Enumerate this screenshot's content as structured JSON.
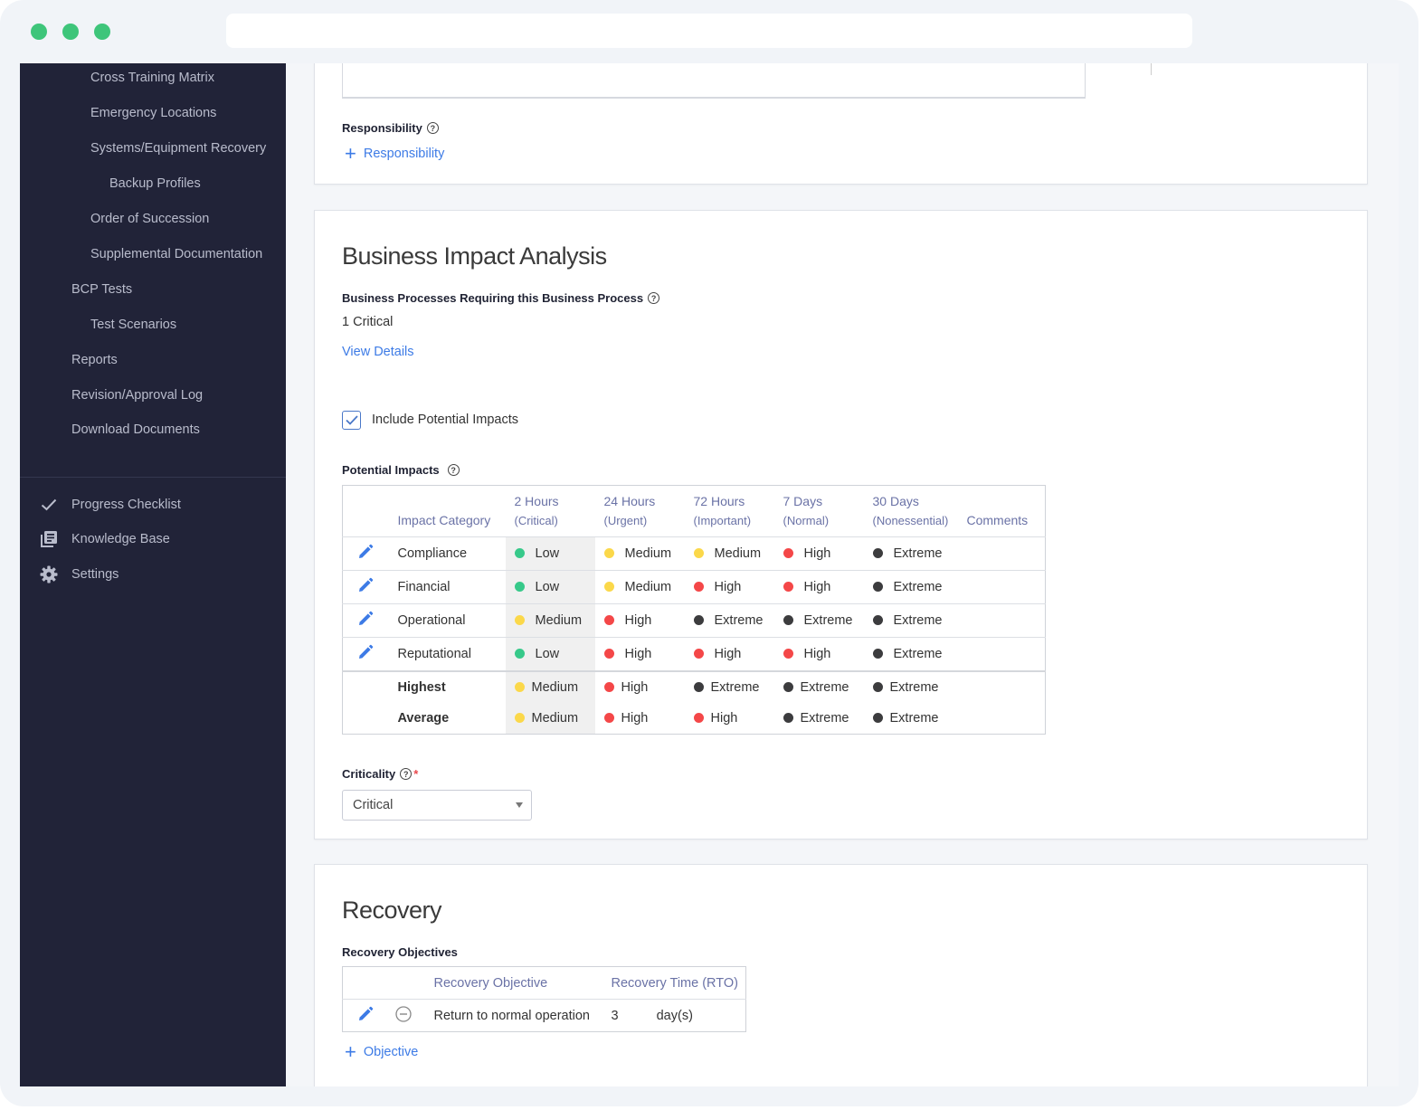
{
  "window": {
    "traffic_lights": [
      "close",
      "minimize",
      "maximize"
    ],
    "accent_color": "#3ec57a"
  },
  "sidebar": {
    "items": [
      {
        "label": "Cross Training Matrix",
        "level": 2
      },
      {
        "label": "Emergency Locations",
        "level": 2
      },
      {
        "label": "Systems/Equipment Recovery",
        "level": 2
      },
      {
        "label": "Backup Profiles",
        "level": 3
      },
      {
        "label": "Order of Succession",
        "level": 2
      },
      {
        "label": "Supplemental Documentation",
        "level": 2
      },
      {
        "label": "BCP Tests",
        "level": 1
      },
      {
        "label": "Test Scenarios",
        "level": 2
      },
      {
        "label": "Reports",
        "level": 1
      },
      {
        "label": "Revision/Approval Log",
        "level": 1
      },
      {
        "label": "Download Documents",
        "level": 1
      }
    ],
    "footer_items": [
      {
        "label": "Progress Checklist",
        "icon": "checkmark-icon"
      },
      {
        "label": "Knowledge Base",
        "icon": "library-icon"
      },
      {
        "label": "Settings",
        "icon": "gear-icon"
      }
    ]
  },
  "responsibility": {
    "label": "Responsibility",
    "add_label": "Responsibility"
  },
  "bia": {
    "title": "Business Impact Analysis",
    "requiring_label": "Business Processes Requiring this Business Process",
    "requiring_value": "1 Critical",
    "view_details": "View Details",
    "include_label": "Include Potential Impacts",
    "include_checked": true,
    "impacts_label": "Potential Impacts",
    "table": {
      "headers": [
        {
          "line1": "Impact Category",
          "line2": ""
        },
        {
          "line1": "2 Hours",
          "line2": "(Critical)"
        },
        {
          "line1": "24 Hours",
          "line2": "(Urgent)"
        },
        {
          "line1": "72 Hours",
          "line2": "(Important)"
        },
        {
          "line1": "7 Days",
          "line2": "(Normal)"
        },
        {
          "line1": "30 Days",
          "line2": "(Nonessential)"
        },
        {
          "line1": "Comments",
          "line2": ""
        }
      ],
      "rows": [
        {
          "category": "Compliance",
          "values": [
            "Low",
            "Medium",
            "Medium",
            "High",
            "Extreme"
          ],
          "comments": ""
        },
        {
          "category": "Financial",
          "values": [
            "Low",
            "Medium",
            "High",
            "High",
            "Extreme"
          ],
          "comments": ""
        },
        {
          "category": "Operational",
          "values": [
            "Medium",
            "High",
            "Extreme",
            "Extreme",
            "Extreme"
          ],
          "comments": ""
        },
        {
          "category": "Reputational",
          "values": [
            "Low",
            "High",
            "High",
            "High",
            "Extreme"
          ],
          "comments": ""
        }
      ],
      "summary": [
        {
          "label": "Highest",
          "values": [
            "Medium",
            "High",
            "Extreme",
            "Extreme",
            "Extreme"
          ]
        },
        {
          "label": "Average",
          "values": [
            "Medium",
            "High",
            "High",
            "Extreme",
            "Extreme"
          ]
        }
      ],
      "level_colors": {
        "Low": "#37c98a",
        "Medium": "#fbd84a",
        "High": "#f44748",
        "Extreme": "#3c3c3e"
      }
    },
    "criticality_label": "Criticality",
    "criticality_value": "Critical"
  },
  "recovery": {
    "title": "Recovery",
    "objectives_label": "Recovery Objectives",
    "headers": [
      "Recovery Objective",
      "Recovery Time (RTO)"
    ],
    "rows": [
      {
        "objective": "Return to normal operation",
        "time": "3",
        "unit": "day(s)"
      }
    ],
    "add_label": "Objective"
  }
}
